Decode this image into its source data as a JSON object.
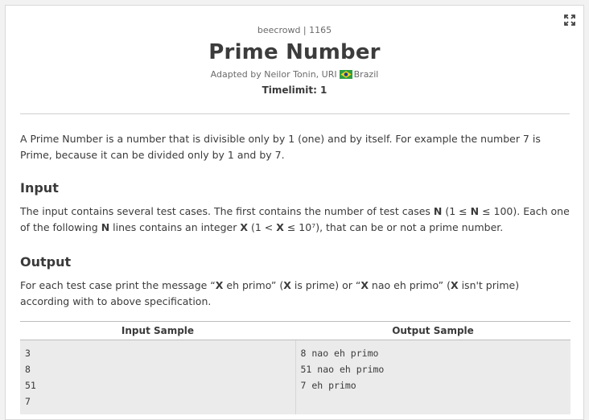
{
  "header": {
    "breadcrumb": "beecrowd | 1165",
    "title": "Prime Number",
    "adapted_prefix": "Adapted by Neilor Tonin, URI",
    "country": "Brazil",
    "timelimit": "Timelimit: 1",
    "flag_icon": "brazil-flag-icon",
    "expand_icon": "expand-icon"
  },
  "description": {
    "text": "A Prime Number is a number that is divisible only by 1 (one) and by itself. For example the number 7 is Prime, because it can be divided only by 1 and by 7."
  },
  "input": {
    "heading": "Input",
    "p1": "The input contains several test cases. The first contains the number of test cases ",
    "n1": "N",
    "p2": " (1 ≤ ",
    "n2": "N",
    "p3": " ≤ 100). Each one of the following ",
    "n3": "N",
    "p4": " lines contains an integer ",
    "x1": "X",
    "p5": " (1 < ",
    "x2": "X",
    "p6": " ≤ 10⁷), that can be or not a prime number."
  },
  "output": {
    "heading": "Output",
    "p1": "For each test case print the message “",
    "x1": "X",
    "p2": " eh primo” (",
    "x2": "X",
    "p3": " is prime) or “",
    "x3": "X",
    "p4": " nao eh primo” (",
    "x4": "X",
    "p5": " isn't prime) according with to above specification."
  },
  "samples": {
    "input_header": "Input Sample",
    "output_header": "Output Sample",
    "input_lines": [
      "3",
      "8",
      "51",
      "7"
    ],
    "output_lines": [
      "8 nao eh primo",
      "51 nao eh primo",
      "7 eh primo"
    ]
  },
  "colors": {
    "background": "#f2f2f2",
    "card": "#ffffff",
    "sample_bg": "#ebebeb",
    "text": "#3a3a3a",
    "flag_green": "#2e9e41",
    "flag_yellow": "#f4d31c",
    "flag_blue": "#1c3f94"
  }
}
